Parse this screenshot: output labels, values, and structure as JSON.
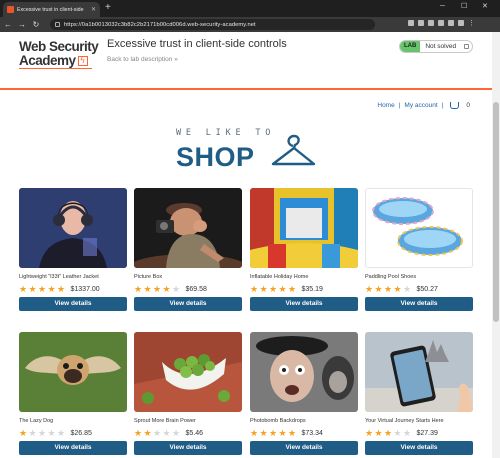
{
  "browser": {
    "tab_title": "Excessive trust in client-side",
    "url": "https://0a1b0013032c3b82c2b2171b00cd006d.web-security-academy.net"
  },
  "header": {
    "logo_line1": "Web Security",
    "logo_line2": "Academy",
    "lab_title": "Excessive trust in client-side controls",
    "back_link": "Back to lab description",
    "lab_badge": "LAB",
    "lab_status": "Not solved"
  },
  "nav": {
    "home": "Home",
    "separator": "|",
    "my_account": "My account",
    "cart_count": "0"
  },
  "hero": {
    "tagline": "WE LIKE TO",
    "title": "SHOP"
  },
  "products": [
    {
      "name": "Lightweight \"l33t\" Leather Jacket",
      "rating": 5,
      "price": "$1337.00",
      "button": "View details"
    },
    {
      "name": "Picture Box",
      "rating": 4,
      "price": "$69.58",
      "button": "View details"
    },
    {
      "name": "Inflatable Holiday Home",
      "rating": 5,
      "price": "$35.19",
      "button": "View details"
    },
    {
      "name": "Paddling Pool Shoes",
      "rating": 4,
      "price": "$50.27",
      "button": "View details"
    },
    {
      "name": "The Lazy Dog",
      "rating": 1,
      "price": "$26.85",
      "button": "View details"
    },
    {
      "name": "Sprout More Brain Power",
      "rating": 2,
      "price": "$5.46",
      "button": "View details"
    },
    {
      "name": "Photobomb Backdrops",
      "rating": 5,
      "price": "$73.34",
      "button": "View details"
    },
    {
      "name": "Your Virtual Journey Starts Here",
      "rating": 3,
      "price": "$27.39",
      "button": "View details"
    }
  ],
  "colors": {
    "accent": "#ff6633",
    "primary": "#1f5c86",
    "star": "#f7a21f",
    "lab_green": "#69c36d"
  }
}
